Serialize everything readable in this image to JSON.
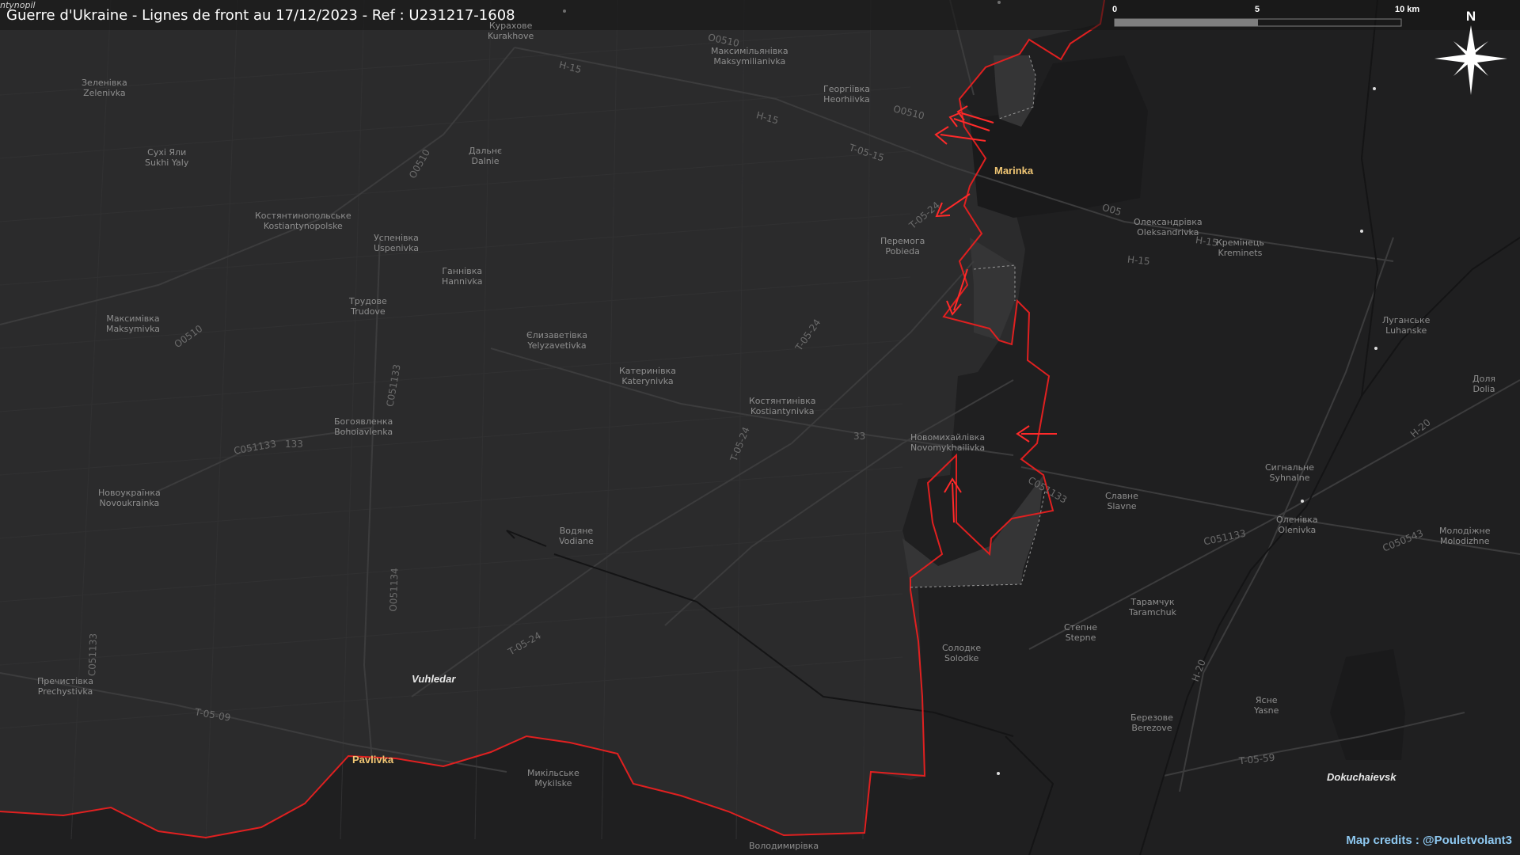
{
  "header": {
    "title": "Guerre d'Ukraine - Lignes de front au 17/12/2023 - Ref : U231217-1608",
    "corner": "ntynopil"
  },
  "credits": "Map credits : @Pouletvolant3",
  "scale": {
    "l0": "0",
    "l5": "5",
    "l10": "10 km"
  },
  "compass": {
    "north": "N"
  },
  "colors": {
    "background": "#2a2a2b",
    "occupied": "#1f1f20",
    "front_line": "#e02020",
    "arrow": "#ff2a2a",
    "town_label": "#f0c674",
    "credits": "#8ec8f0"
  },
  "towns": {
    "marinka": "Marinka",
    "vuhledar": "Vuhledar",
    "pavlivka": "Pavlivka",
    "dokuchaievsk": "Dokuchaievsk"
  },
  "villages": [
    {
      "uk": "Зеленівка",
      "en": "Zelenivka"
    },
    {
      "uk": "Сухі Яли",
      "en": "Sukhi Yaly"
    },
    {
      "uk": "Дальнє",
      "en": "Dalnie"
    },
    {
      "uk": "Костянтинопольське",
      "en": "Kostiantynopolske"
    },
    {
      "uk": "Успенівка",
      "en": "Uspenivka"
    },
    {
      "uk": "Ганнівка",
      "en": "Hannivka"
    },
    {
      "uk": "Трудове",
      "en": "Trudove"
    },
    {
      "uk": "Максимівка",
      "en": "Maksymivka"
    },
    {
      "uk": "Єлизаветівка",
      "en": "Yelyzavetivka"
    },
    {
      "uk": "Катеринівка",
      "en": "Katerynivka"
    },
    {
      "uk": "Костянтинівка",
      "en": "Kostiantynivka"
    },
    {
      "uk": "Богоявленка",
      "en": "Bohoiavlenka"
    },
    {
      "uk": "Новоукраїнка",
      "en": "Novoukrainka"
    },
    {
      "uk": "Водяне",
      "en": "Vodiane"
    },
    {
      "uk": "Пречистівка",
      "en": "Prechystivka"
    },
    {
      "uk": "Микільське",
      "en": "Mykilske"
    },
    {
      "uk": "Максимільянівка",
      "en": "Maksymilianivka"
    },
    {
      "uk": "Георгіївка",
      "en": "Heorhiivka"
    },
    {
      "uk": "Перемога",
      "en": "Pobieda"
    },
    {
      "uk": "Новомихайлівка",
      "en": "Novomykhailivka"
    },
    {
      "uk": "Олександрівка",
      "en": "Oleksandrivka"
    },
    {
      "uk": "Кремінець",
      "en": "Kreminets"
    },
    {
      "uk": "Луганське",
      "en": "Luhanske"
    },
    {
      "uk": "Доля",
      "en": "Dolia"
    },
    {
      "uk": "Сигнальне",
      "en": "Syhnalne"
    },
    {
      "uk": "Славне",
      "en": "Slavne"
    },
    {
      "uk": "Оленівка",
      "en": "Olenivka"
    },
    {
      "uk": "Молодіжне",
      "en": "Molodizhne"
    },
    {
      "uk": "Тарамчук",
      "en": "Taramchuk"
    },
    {
      "uk": "Степне",
      "en": "Stepne"
    },
    {
      "uk": "Солодке",
      "en": "Solodke"
    },
    {
      "uk": "Ясне",
      "en": "Yasne"
    },
    {
      "uk": "Березове",
      "en": "Berezove"
    },
    {
      "uk": "Курахове",
      "en": "Kurakhove"
    },
    {
      "uk": "Володимирівка",
      "en": ""
    }
  ],
  "roads": [
    "H-15",
    "H-15",
    "T-05-15",
    "O0510",
    "O0510",
    "O0510",
    "O0510",
    "O0510",
    "T-05-24",
    "T-05-24",
    "T-05-24",
    "C051133",
    "C051133",
    "C051133",
    "O051134",
    "O051134",
    "T-05-09",
    "H-15",
    "H-20",
    "T-05-59",
    "C050543",
    "T-05-24",
    "133",
    "33",
    "C051133",
    "O05",
    "O0510",
    "H-15",
    "H-15"
  ]
}
